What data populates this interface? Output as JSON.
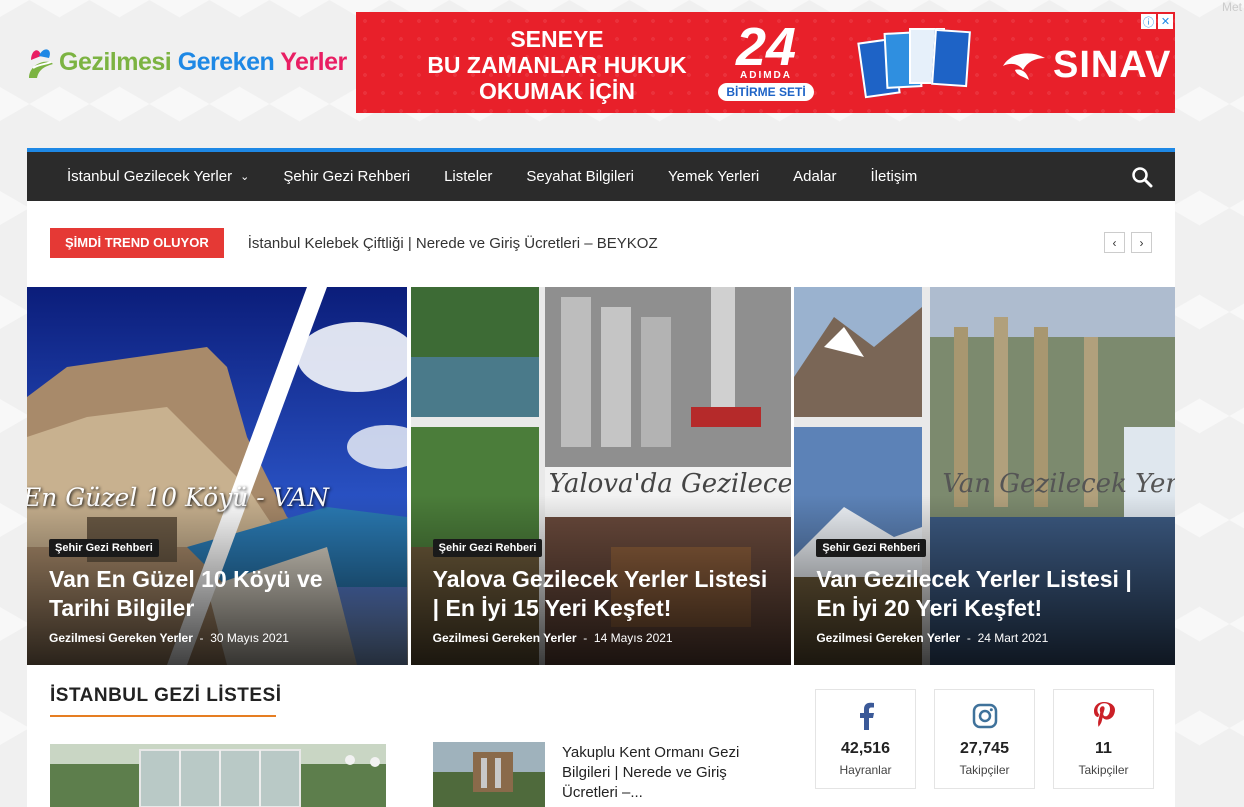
{
  "corner_label": "Met",
  "logo": {
    "part1": "Gezilmesi",
    "part2": "Gereken",
    "part3": "Yerler"
  },
  "ad": {
    "line1": "SENEYE",
    "line2": "BU ZAMANLAR HUKUK",
    "line3": "OKUMAK İÇİN",
    "big_number": "24",
    "subtitle": "ADIMDA",
    "set_label": "BİTİRME SETİ",
    "brand": "SINAV",
    "info_icon": "info-icon",
    "close_icon": "close-icon"
  },
  "nav": {
    "items": [
      "İstanbul Gezilecek Yerler",
      "Şehir Gezi Rehberi",
      "Listeler",
      "Seyahat Bilgileri",
      "Yemek Yerleri",
      "Adalar",
      "İletişim"
    ],
    "search_icon": "search-icon"
  },
  "trend": {
    "badge": "ŞİMDİ TREND OLUYOR",
    "text": "İstanbul Kelebek Çiftliği | Nerede ve Giriş Ücretleri – BEYKOZ",
    "prev": "‹",
    "next": "›"
  },
  "featured": [
    {
      "overlay": "En Güzel 10 Köyü - VAN",
      "category": "Şehir Gezi Rehberi",
      "title": "Van En Güzel 10 Köyü ve Tarihi Bilgiler",
      "author": "Gezilmesi Gereken Yerler",
      "date": "30 Mayıs 2021"
    },
    {
      "overlay": "Yalova'da Gezilecek Ye",
      "category": "Şehir Gezi Rehberi",
      "title": "Yalova Gezilecek Yerler Listesi | En İyi 15 Yeri Keşfet!",
      "author": "Gezilmesi Gereken Yerler",
      "date": "14 Mayıs 2021"
    },
    {
      "overlay": "Van Gezilecek Yerle",
      "category": "Şehir Gezi Rehberi",
      "title": "Van Gezilecek Yerler Listesi | En İyi 20 Yeri Keşfet!",
      "author": "Gezilmesi Gereken Yerler",
      "date": "24 Mart 2021"
    }
  ],
  "section": {
    "title": "İSTANBUL GEZİ LİSTESİ",
    "post_title": "Yakuplu Kent Ormanı Gezi Bilgileri | Nerede ve Giriş Ücretleri –..."
  },
  "social": [
    {
      "icon": "facebook-icon",
      "count": "42,516",
      "label": "Hayranlar",
      "color": "#3b5998"
    },
    {
      "icon": "instagram-icon",
      "count": "27,745",
      "label": "Takipçiler",
      "color": "#3f729b"
    },
    {
      "icon": "pinterest-icon",
      "count": "11",
      "label": "Takipçiler",
      "color": "#cb2027"
    }
  ],
  "colors": {
    "accent_blue": "#1e88e5",
    "nav_bg": "#2b2b2b",
    "trend_red": "#e53935",
    "section_underline": "#e67e22",
    "ad_red": "#e8202a"
  }
}
